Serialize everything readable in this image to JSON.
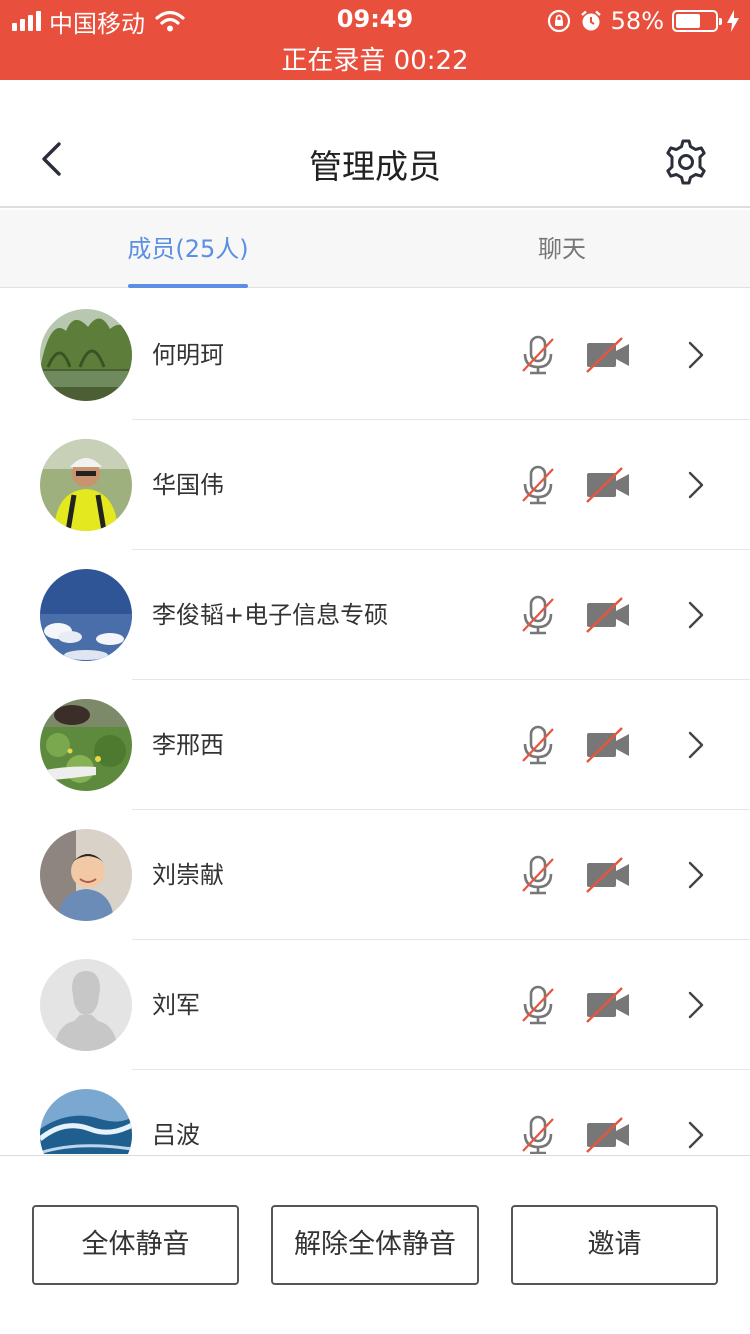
{
  "status_bar": {
    "carrier": "中国移动",
    "time": "09:49",
    "battery_percent": "58%",
    "battery_level": 0.58,
    "recording": "正在录音 00:22",
    "background_color": "#e84f3d"
  },
  "nav": {
    "title": "管理成员",
    "back_icon": "chevron-left-icon",
    "settings_icon": "gear-icon"
  },
  "tabs": [
    {
      "label": "成员(25人)",
      "active": true
    },
    {
      "label": "聊天",
      "active": false
    }
  ],
  "accent_color": "#5b8fe3",
  "members": [
    {
      "name": "何明珂",
      "mic_muted": true,
      "camera_off": true
    },
    {
      "name": "华国伟",
      "mic_muted": true,
      "camera_off": true
    },
    {
      "name": "李俊韬+电子信息专硕",
      "mic_muted": true,
      "camera_off": true
    },
    {
      "name": "李邢西",
      "mic_muted": true,
      "camera_off": true
    },
    {
      "name": "刘崇献",
      "mic_muted": true,
      "camera_off": true
    },
    {
      "name": "刘军",
      "mic_muted": true,
      "camera_off": true
    },
    {
      "name": "吕波",
      "mic_muted": true,
      "camera_off": true
    }
  ],
  "bottom_actions": {
    "mute_all": "全体静音",
    "unmute_all": "解除全体静音",
    "invite": "邀请"
  }
}
